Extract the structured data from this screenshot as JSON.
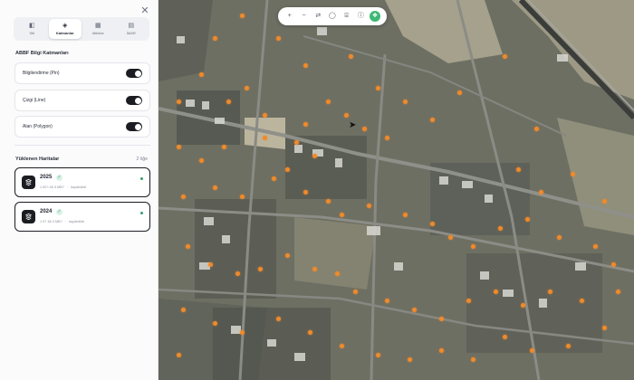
{
  "panel": {
    "close_icon": "close-icon",
    "tabs": [
      {
        "label": "Stil",
        "icon": "palette-icon",
        "active": false
      },
      {
        "label": "Katmanlar",
        "icon": "layers-icon",
        "active": true
      },
      {
        "label": "Altlıklar",
        "icon": "basemap-icon",
        "active": false
      },
      {
        "label": "İMAR",
        "icon": "zoning-icon",
        "active": false
      }
    ],
    "layers_section_title": "ABBF Bilgi Katmanları",
    "layers": [
      {
        "label": "Bilgilendirme (Pin)",
        "on": true
      },
      {
        "label": "Çizgi (Line)",
        "on": true
      },
      {
        "label": "Alan (Polygon)",
        "on": true
      }
    ],
    "maps_section_title": "Yüklenen Haritalar",
    "maps_count": "2 öğe",
    "maps": [
      {
        "year": "2025",
        "meta1": "1.90? 48.3 MB?",
        "meta2": "kaydedildi"
      },
      {
        "year": "2024",
        "meta1": "1.97 48.3 MB?",
        "meta2": "kaydedildi"
      }
    ]
  },
  "map": {
    "toolbar": [
      {
        "icon": "zoom-in-icon",
        "glyph": "+"
      },
      {
        "icon": "zoom-out-icon",
        "glyph": "−"
      },
      {
        "icon": "compare-icon",
        "glyph": "⇄"
      },
      {
        "icon": "pointer-icon",
        "glyph": "◯"
      },
      {
        "icon": "tag-icon",
        "glyph": "⌸"
      },
      {
        "icon": "info-icon",
        "glyph": "ⓘ"
      },
      {
        "icon": "layers-active-icon",
        "glyph": "❖"
      }
    ],
    "accent": "#f08a2a",
    "active_tool_color": "#3fb875"
  }
}
